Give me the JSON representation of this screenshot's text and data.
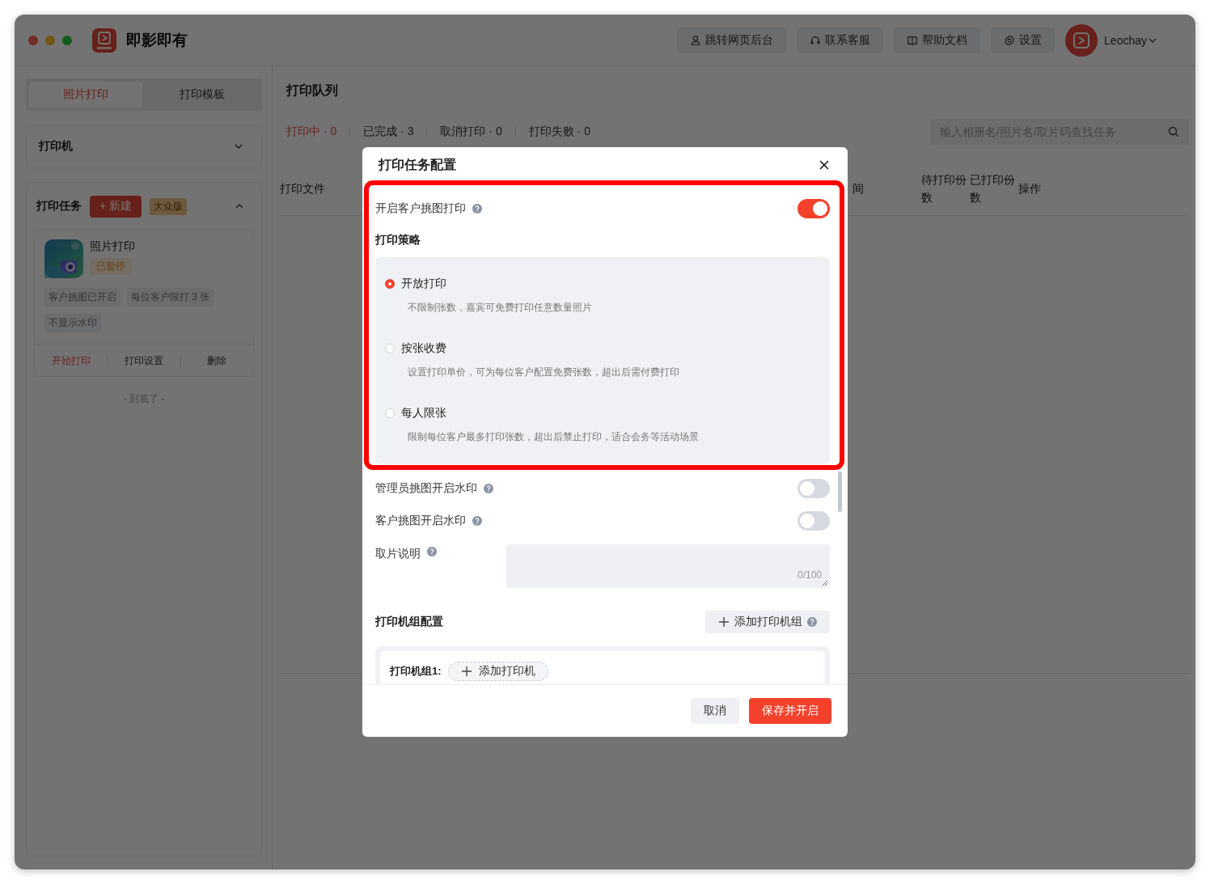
{
  "app": {
    "name": "即影即有"
  },
  "toolbar": [
    {
      "label": "跳转网页后台",
      "kind": "user"
    },
    {
      "label": "联系客服",
      "kind": "headset"
    },
    {
      "label": "帮助文档",
      "kind": "book"
    },
    {
      "label": "设置",
      "kind": "gear"
    }
  ],
  "user": {
    "name": "Leochay"
  },
  "sidebar": {
    "tabs": [
      {
        "label": "照片打印",
        "selected": true
      },
      {
        "label": "打印模板",
        "selected": false
      }
    ],
    "printer_section": {
      "title": "打印机",
      "expanded": false
    },
    "tasks_section": {
      "title": "打印任务",
      "new_button": "+ 新建",
      "edition_badge": "大众版",
      "expanded": true
    },
    "tasks": [
      {
        "title": "照片打印",
        "status": "已暂停",
        "tags": [
          "客户挑图已开启",
          "每位客户限打 3 张",
          "不显示水印"
        ],
        "actions": [
          {
            "label": "开始打印",
            "kind": "primary"
          },
          {
            "label": "打印设置",
            "kind": "normal"
          },
          {
            "label": "删除",
            "kind": "normal"
          }
        ]
      }
    ],
    "end_note": "- 到底了 -"
  },
  "queue": {
    "title": "打印队列",
    "filters": [
      {
        "label": "打印中 · 0",
        "selected": true
      },
      {
        "label": "已完成 · 3",
        "selected": false
      },
      {
        "label": "取消打印 · 0",
        "selected": false
      },
      {
        "label": "打印失败 · 0",
        "selected": false
      }
    ],
    "search": {
      "placeholder": "输入相册名/照片名/取片码查找任务"
    },
    "columns": [
      "打印文件",
      "间",
      "待打印份数",
      "已打印份数",
      "操作"
    ]
  },
  "dialog": {
    "title": "打印任务配置",
    "main_switch": {
      "label": "开启客户挑图打印",
      "on": true
    },
    "strategy": {
      "title": "打印策略",
      "options": [
        {
          "label": "开放打印",
          "description": "不限制张数，嘉宾可免费打印任意数量照片",
          "selected": true
        },
        {
          "label": "按张收费",
          "description": "设置打印单价，可为每位客户配置免费张数，超出后需付费打印",
          "selected": false
        },
        {
          "label": "每人限张",
          "description": "限制每位客户最多打印张数，超出后禁止打印，适合会务等活动场景",
          "selected": false
        }
      ]
    },
    "switches": [
      {
        "label": "管理员挑图开启水印",
        "on": false
      },
      {
        "label": "客户挑图开启水印",
        "on": false
      }
    ],
    "pickup_note": {
      "label": "取片说明",
      "counter": "0/100"
    },
    "printer_groups": {
      "title": "打印机组配置",
      "add_button": "添加打印机组",
      "groups": [
        {
          "title": "打印机组1:",
          "add_button": "添加打印机"
        }
      ]
    },
    "buttons": [
      {
        "label": "取消",
        "kind": "secondary"
      },
      {
        "label": "保存并开启",
        "kind": "primary"
      }
    ]
  },
  "annotation": {
    "kind": "frame"
  }
}
